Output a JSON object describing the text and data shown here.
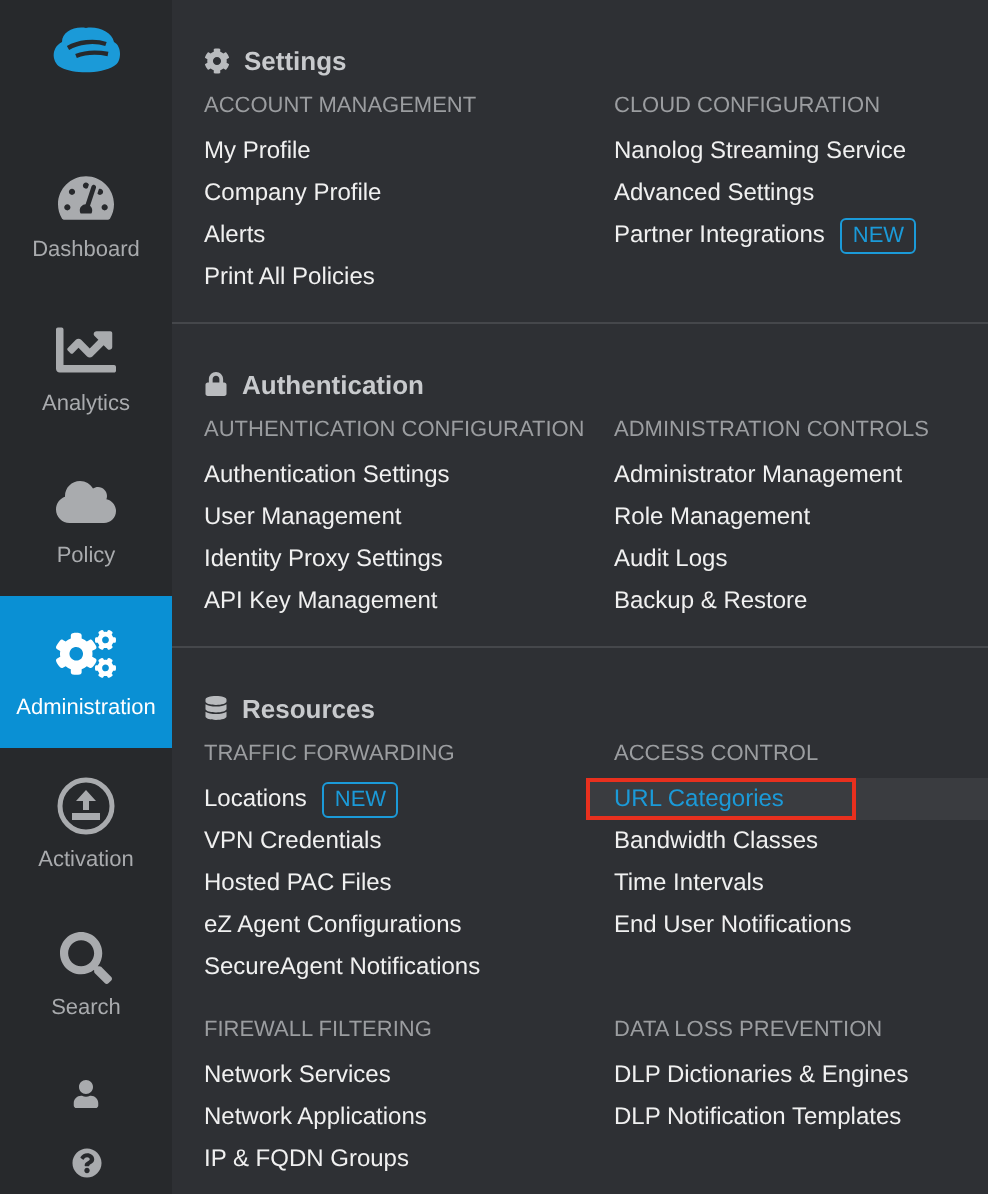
{
  "sidebar": {
    "items": [
      {
        "label": "Dashboard",
        "selected": false
      },
      {
        "label": "Analytics",
        "selected": false
      },
      {
        "label": "Policy",
        "selected": false
      },
      {
        "label": "Administration",
        "selected": true
      },
      {
        "label": "Activation",
        "selected": false
      },
      {
        "label": "Search",
        "selected": false
      }
    ]
  },
  "menu": {
    "sections": [
      {
        "title": "Settings",
        "groups": [
          {
            "heading": "ACCOUNT MANAGEMENT",
            "items": [
              {
                "label": "My Profile",
                "selected": false
              },
              {
                "label": "Company Profile",
                "selected": false
              },
              {
                "label": "Alerts",
                "selected": false
              },
              {
                "label": "Print All Policies",
                "selected": false
              }
            ]
          },
          {
            "heading": "CLOUD CONFIGURATION",
            "items": [
              {
                "label": "Nanolog Streaming Service",
                "selected": false
              },
              {
                "label": "Advanced Settings",
                "selected": false
              },
              {
                "label": "Partner Integrations",
                "badge": "NEW",
                "selected": false
              }
            ]
          }
        ]
      },
      {
        "title": "Authentication",
        "groups": [
          {
            "heading": "AUTHENTICATION CONFIGURATION",
            "items": [
              {
                "label": "Authentication Settings",
                "selected": false
              },
              {
                "label": "User Management",
                "selected": false
              },
              {
                "label": "Identity Proxy Settings",
                "selected": false
              },
              {
                "label": "API Key Management",
                "selected": false
              }
            ]
          },
          {
            "heading": "ADMINISTRATION CONTROLS",
            "items": [
              {
                "label": "Administrator Management",
                "selected": false
              },
              {
                "label": "Role Management",
                "selected": false
              },
              {
                "label": "Audit Logs",
                "selected": false
              },
              {
                "label": "Backup & Restore",
                "selected": false
              }
            ]
          }
        ]
      },
      {
        "title": "Resources",
        "groups": [
          {
            "heading": "TRAFFIC FORWARDING",
            "items": [
              {
                "label": "Locations",
                "badge": "NEW",
                "selected": false
              },
              {
                "label": "VPN Credentials",
                "selected": false
              },
              {
                "label": "Hosted PAC Files",
                "selected": false
              },
              {
                "label": "eZ Agent Configurations",
                "selected": false
              },
              {
                "label": "SecureAgent Notifications",
                "selected": false
              }
            ]
          },
          {
            "heading": "ACCESS CONTROL",
            "items": [
              {
                "label": "URL Categories",
                "selected": true
              },
              {
                "label": "Bandwidth Classes",
                "selected": false
              },
              {
                "label": "Time Intervals",
                "selected": false
              },
              {
                "label": "End User Notifications",
                "selected": false
              }
            ]
          },
          {
            "heading": "FIREWALL FILTERING",
            "items": [
              {
                "label": "Network Services",
                "selected": false
              },
              {
                "label": "Network Applications",
                "selected": false
              },
              {
                "label": "IP & FQDN Groups",
                "selected": false
              }
            ]
          },
          {
            "heading": "DATA LOSS PREVENTION",
            "items": [
              {
                "label": "DLP Dictionaries & Engines",
                "selected": false
              },
              {
                "label": "DLP Notification Templates",
                "selected": false
              }
            ]
          }
        ]
      }
    ]
  }
}
